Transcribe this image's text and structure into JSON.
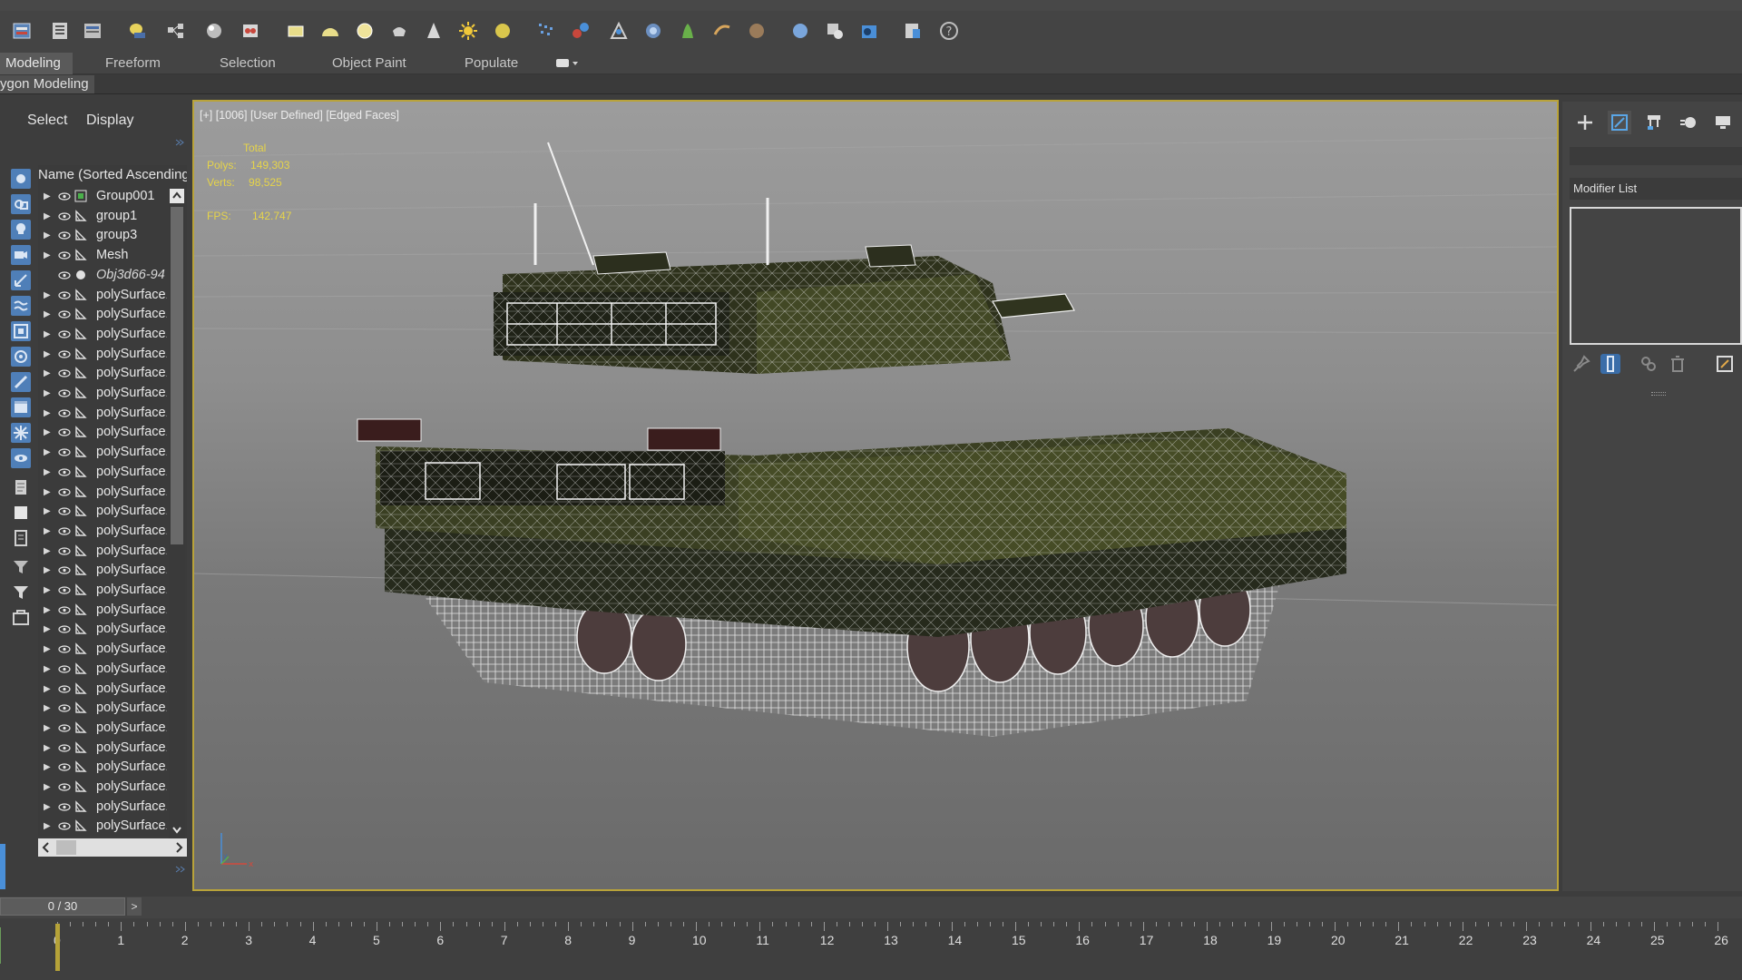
{
  "ribbon": {
    "tabs": [
      "Modeling",
      "Freeform",
      "Selection",
      "Object Paint",
      "Populate"
    ],
    "active_tab": "Modeling",
    "sub_label": "ygon Modeling"
  },
  "explorer": {
    "menu_select": "Select",
    "menu_display": "Display",
    "column_header": "Name (Sorted Ascending",
    "items": [
      {
        "name": "Group001",
        "expandable": true,
        "italic": false
      },
      {
        "name": "group1",
        "expandable": true,
        "italic": false
      },
      {
        "name": "group3",
        "expandable": true,
        "italic": false
      },
      {
        "name": "Mesh",
        "expandable": true,
        "italic": false
      },
      {
        "name": "Obj3d66-94",
        "expandable": false,
        "italic": true
      },
      {
        "name": "polySurface1",
        "expandable": true,
        "italic": false
      },
      {
        "name": "polySurface1",
        "expandable": true,
        "italic": false
      },
      {
        "name": "polySurface1",
        "expandable": true,
        "italic": false
      },
      {
        "name": "polySurface1",
        "expandable": true,
        "italic": false
      },
      {
        "name": "polySurface1",
        "expandable": true,
        "italic": false
      },
      {
        "name": "polySurface1",
        "expandable": true,
        "italic": false
      },
      {
        "name": "polySurface1",
        "expandable": true,
        "italic": false
      },
      {
        "name": "polySurface1",
        "expandable": true,
        "italic": false
      },
      {
        "name": "polySurface1",
        "expandable": true,
        "italic": false
      },
      {
        "name": "polySurface1",
        "expandable": true,
        "italic": false
      },
      {
        "name": "polySurface1",
        "expandable": true,
        "italic": false
      },
      {
        "name": "polySurface1",
        "expandable": true,
        "italic": false
      },
      {
        "name": "polySurface1",
        "expandable": true,
        "italic": false
      },
      {
        "name": "polySurface1",
        "expandable": true,
        "italic": false
      },
      {
        "name": "polySurface1",
        "expandable": true,
        "italic": false
      },
      {
        "name": "polySurface1",
        "expandable": true,
        "italic": false
      },
      {
        "name": "polySurface1",
        "expandable": true,
        "italic": false
      },
      {
        "name": "polySurface1",
        "expandable": true,
        "italic": false
      },
      {
        "name": "polySurface1",
        "expandable": true,
        "italic": false
      },
      {
        "name": "polySurface1",
        "expandable": true,
        "italic": false
      },
      {
        "name": "polySurface1",
        "expandable": true,
        "italic": false
      },
      {
        "name": "polySurface1",
        "expandable": true,
        "italic": false
      },
      {
        "name": "polySurface1",
        "expandable": true,
        "italic": false
      },
      {
        "name": "polySurface1",
        "expandable": true,
        "italic": false
      },
      {
        "name": "polySurface1",
        "expandable": true,
        "italic": false
      },
      {
        "name": "polySurface1",
        "expandable": true,
        "italic": false
      },
      {
        "name": "polySurface1",
        "expandable": true,
        "italic": false
      },
      {
        "name": "polySurface1",
        "expandable": true,
        "italic": false
      },
      {
        "name": "polySurface1",
        "expandable": true,
        "italic": false
      },
      {
        "name": "polySurface1",
        "expandable": true,
        "italic": false
      },
      {
        "name": "polySurface1",
        "expandable": true,
        "italic": false
      },
      {
        "name": "polySurface1",
        "expandable": true,
        "italic": false
      },
      {
        "name": "polySurface1",
        "expandable": true,
        "italic": false
      },
      {
        "name": "polySurface1",
        "expandable": true,
        "italic": false
      },
      {
        "name": "polySurface1",
        "expandable": true,
        "italic": false
      },
      {
        "name": "polySurface1",
        "expandable": true,
        "italic": false
      },
      {
        "name": "polySurface1",
        "expandable": true,
        "italic": false
      },
      {
        "name": "polySurface1",
        "expandable": true,
        "italic": false
      },
      {
        "name": "polySurface1",
        "expandable": true,
        "italic": false
      },
      {
        "name": "polySurface1",
        "expandable": true,
        "italic": false
      },
      {
        "name": "polySurface1",
        "expandable": true,
        "italic": false
      },
      {
        "name": "polySurface1",
        "expandable": true,
        "italic": false
      },
      {
        "name": "polySurface1",
        "expandable": true,
        "italic": false
      },
      {
        "name": "polySurface1",
        "expandable": true,
        "italic": false
      },
      {
        "name": "polySurface1",
        "expandable": true,
        "italic": false
      },
      {
        "name": "polySurface1",
        "expandable": true,
        "italic": false
      },
      {
        "name": "polySurface1",
        "expandable": true,
        "italic": false
      },
      {
        "name": "polySurface1",
        "expandable": true,
        "italic": false
      },
      {
        "name": "polySurface1",
        "expandable": true,
        "italic": false
      },
      {
        "name": "polySurface1",
        "expandable": true,
        "italic": false
      },
      {
        "name": "polySurface1",
        "expandable": true,
        "italic": false
      },
      {
        "name": "polySurface1",
        "expandable": true,
        "italic": false
      },
      {
        "name": "polySurface1",
        "expandable": true,
        "italic": false
      },
      {
        "name": "polySurface1",
        "expandable": true,
        "italic": false
      },
      {
        "name": "polySurface1",
        "expandable": true,
        "italic": false
      },
      {
        "name": "polySurface1",
        "expandable": true,
        "italic": false
      },
      {
        "name": "polySurface1",
        "expandable": true,
        "italic": false
      },
      {
        "name": "polySurface1",
        "expandable": true,
        "italic": false
      },
      {
        "name": "polySurface1",
        "expandable": true,
        "italic": false
      },
      {
        "name": "polySurface1",
        "expandable": true,
        "italic": false
      },
      {
        "name": "polySurface1",
        "expandable": true,
        "italic": false
      },
      {
        "name": "polySurface1",
        "expandable": true,
        "italic": false
      },
      {
        "name": "polySurface1",
        "expandable": true,
        "italic": false
      },
      {
        "name": "polySurface1",
        "expandable": true,
        "italic": false
      },
      {
        "name": "polySurface1",
        "expandable": true,
        "italic": false
      },
      {
        "name": "polySurface1",
        "expandable": true,
        "italic": false
      },
      {
        "name": "polySurface1",
        "expandable": true,
        "italic": false
      },
      {
        "name": "polySurface1",
        "expandable": true,
        "italic": false
      },
      {
        "name": "polySurface1",
        "expandable": true,
        "italic": false
      },
      {
        "name": "polySurface1",
        "expandable": true,
        "italic": false
      },
      {
        "name": "polySurface1",
        "expandable": true,
        "italic": false
      },
      {
        "name": "polySurface1",
        "expandable": true,
        "italic": false
      },
      {
        "name": "polySurface1",
        "expandable": true,
        "italic": false
      },
      {
        "name": "polySurface1",
        "expandable": true,
        "italic": false
      },
      {
        "name": "polySurface1",
        "expandable": true,
        "italic": false
      },
      {
        "name": "polySurface1",
        "expandable": true,
        "italic": false
      },
      {
        "name": "polySurface1",
        "expandable": true,
        "italic": false
      },
      {
        "name": "polySurface1",
        "expandable": true,
        "italic": false
      },
      {
        "name": "polySurface1",
        "expandable": true,
        "italic": false
      },
      {
        "name": "polySurface1",
        "expandable": true,
        "italic": false
      },
      {
        "name": "polySurface1",
        "expandable": true,
        "italic": false
      },
      {
        "name": "polySurface1",
        "expandable": true,
        "italic": false
      },
      {
        "name": "polySurface1",
        "expandable": true,
        "italic": false
      },
      {
        "name": "polySurface1",
        "expandable": true,
        "italic": false
      },
      {
        "name": "polySurface1",
        "expandable": true,
        "italic": false
      },
      {
        "name": "polySurface1",
        "expandable": true,
        "italic": false
      },
      {
        "name": "polySurface1",
        "expandable": true,
        "italic": false
      },
      {
        "name": "polySurface1",
        "expandable": true,
        "italic": false
      },
      {
        "name": "polySurface1",
        "expandable": true,
        "italic": false
      },
      {
        "name": "polySurface1",
        "expandable": true,
        "italic": false
      },
      {
        "name": "polySurface1",
        "expandable": true,
        "italic": false
      },
      {
        "name": "polySurface1",
        "expandable": true,
        "italic": false
      },
      {
        "name": "polySurface1",
        "expandable": true,
        "italic": false
      },
      {
        "name": "polySurface1",
        "expandable": true,
        "italic": false
      },
      {
        "name": "polySurface1",
        "expandable": true,
        "italic": false
      },
      {
        "name": "polySurface1",
        "expandable": true,
        "italic": false
      },
      {
        "name": "polySurface1",
        "expandable": true,
        "italic": false
      },
      {
        "name": "polySurface1",
        "expandable": true,
        "italic": false
      }
    ]
  },
  "viewport": {
    "label": "[+] [1006] [User Defined] [Edged Faces]",
    "stats": {
      "total_label": "Total",
      "polys_label": "Polys:",
      "polys_value": "149,303",
      "verts_label": "Verts:",
      "verts_value": "98,525",
      "fps_label": "FPS:",
      "fps_value": "142.747"
    },
    "axis": {
      "x": "x",
      "y": "y"
    }
  },
  "command_panel": {
    "modifier_list": "Modifier List"
  },
  "timeline": {
    "frame_display": "0 / 30",
    "next_label": ">",
    "ticks": [
      "0",
      "1",
      "2",
      "3",
      "4",
      "5",
      "6",
      "7",
      "8",
      "9",
      "10",
      "11",
      "12",
      "13",
      "14",
      "15",
      "16",
      "17",
      "18",
      "19",
      "20",
      "21",
      "22",
      "23",
      "24",
      "25",
      "26"
    ],
    "current_frame": 0,
    "total_frames": 30
  },
  "colors": {
    "viewport_border": "#b9a33a",
    "stats_text": "#e6d44a",
    "accent_blue": "#4a8fd8"
  }
}
